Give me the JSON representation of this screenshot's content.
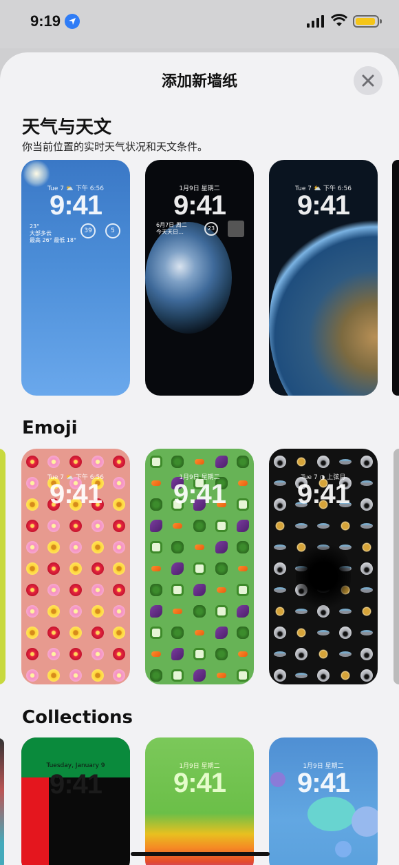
{
  "status_bar": {
    "time": "9:19",
    "icons": [
      "location-arrow-icon",
      "cellular-signal-icon",
      "wifi-icon",
      "battery-icon"
    ],
    "battery_color": "#f5c518"
  },
  "sheet": {
    "title": "添加新墙纸",
    "close_icon": "close-icon"
  },
  "sections": {
    "weather": {
      "title": "天气与天文",
      "subtitle": "你当前位置的实时天气状况和天文条件。",
      "cards": [
        {
          "date": "Tue 7  ⛅  下午 6:56",
          "clock": "9:41",
          "temp": "23°",
          "cond": "大部多云",
          "range": "最高 26° 最低 18°",
          "ring1": "39",
          "ring2": "5"
        },
        {
          "date": "1月9日 星期二",
          "clock": "9:41",
          "detail1": "6月7日 周二",
          "detail2": "今天天日…",
          "ring": "23"
        },
        {
          "date": "Tue 7  ⛅  下午 6:56",
          "clock": "9:41"
        }
      ]
    },
    "emoji": {
      "title": "Emoji",
      "cards": [
        {
          "date": "Tue 7  ⛅  下午 6:56",
          "clock": "9:41"
        },
        {
          "date": "1月9日 星期二",
          "clock": "9:41"
        },
        {
          "date": "Tue 7  ◑  上弦月",
          "clock": "9:41"
        }
      ]
    },
    "collections": {
      "title": "Collections",
      "cards": [
        {
          "date": "Tuesday, January 9",
          "clock": "9:41"
        },
        {
          "date": "1月9日 星期二",
          "clock": "9:41"
        },
        {
          "date": "1月9日 星期二",
          "clock": "9:41"
        }
      ]
    }
  },
  "colors": {
    "sheet_bg": "#f2f2f4",
    "accent_blue": "#2f7cf6"
  }
}
